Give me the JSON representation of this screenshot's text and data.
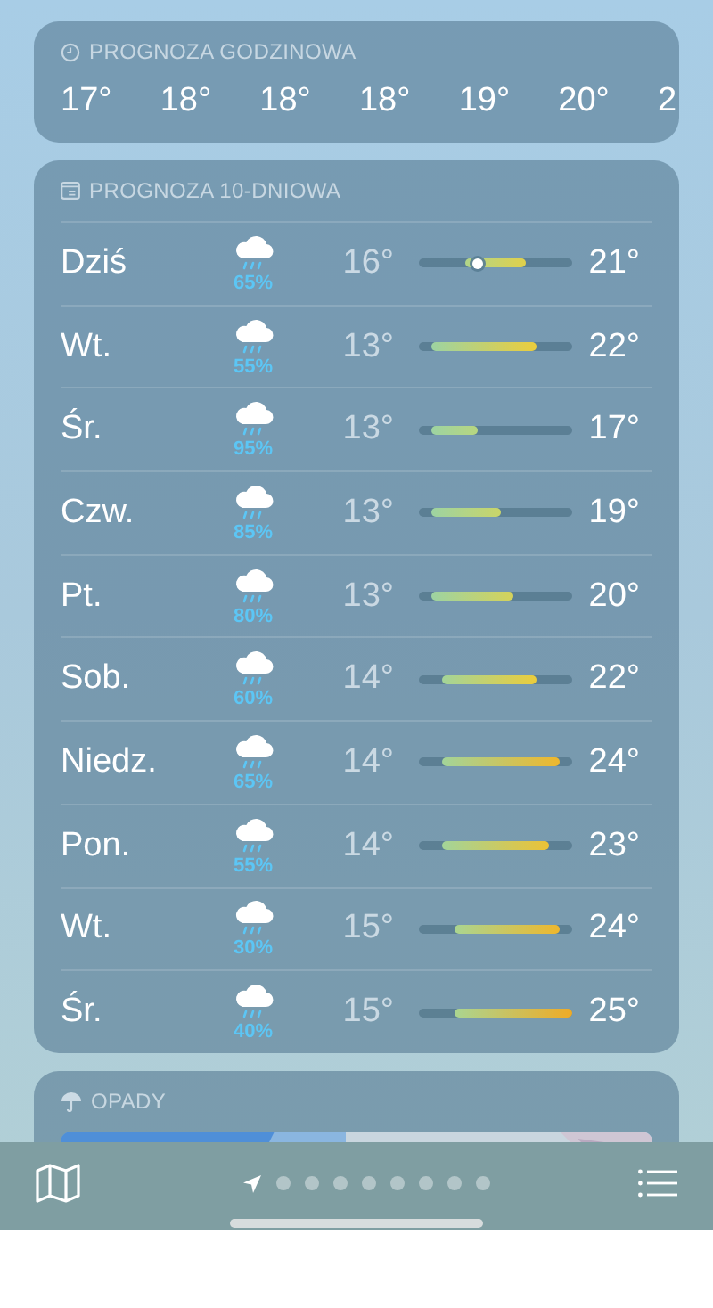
{
  "hourly": {
    "title": "PROGNOZA GODZINOWA",
    "temps": [
      "17°",
      "18°",
      "18°",
      "18°",
      "19°",
      "20°",
      "2"
    ]
  },
  "daily": {
    "title": "PROGNOZA 10-DNIOWA",
    "days": [
      {
        "day": "Dziś",
        "chance": "65%",
        "low": "16°",
        "high": "21°",
        "current": true
      },
      {
        "day": "Wt.",
        "chance": "55%",
        "low": "13°",
        "high": "22°",
        "current": false
      },
      {
        "day": "Śr.",
        "chance": "95%",
        "low": "13°",
        "high": "17°",
        "current": false
      },
      {
        "day": "Czw.",
        "chance": "85%",
        "low": "13°",
        "high": "19°",
        "current": false
      },
      {
        "day": "Pt.",
        "chance": "80%",
        "low": "13°",
        "high": "20°",
        "current": false
      },
      {
        "day": "Sob.",
        "chance": "60%",
        "low": "14°",
        "high": "22°",
        "current": false
      },
      {
        "day": "Niedz.",
        "chance": "65%",
        "low": "14°",
        "high": "24°",
        "current": false
      },
      {
        "day": "Pon.",
        "chance": "55%",
        "low": "14°",
        "high": "23°",
        "current": false
      },
      {
        "day": "Wt.",
        "chance": "30%",
        "low": "15°",
        "high": "24°",
        "current": false
      },
      {
        "day": "Śr.",
        "chance": "40%",
        "low": "15°",
        "high": "25°",
        "current": false
      }
    ]
  },
  "precipitation": {
    "title": "OPADY"
  },
  "pages": [
    {
      "kind": "location",
      "selected": true
    },
    {
      "kind": "dot",
      "selected": false
    },
    {
      "kind": "dot",
      "selected": false
    },
    {
      "kind": "dot",
      "selected": false
    },
    {
      "kind": "dot",
      "selected": false
    },
    {
      "kind": "dot",
      "selected": false
    },
    {
      "kind": "dot",
      "selected": false
    },
    {
      "kind": "dot",
      "selected": false
    },
    {
      "kind": "dot",
      "selected": false
    }
  ]
}
